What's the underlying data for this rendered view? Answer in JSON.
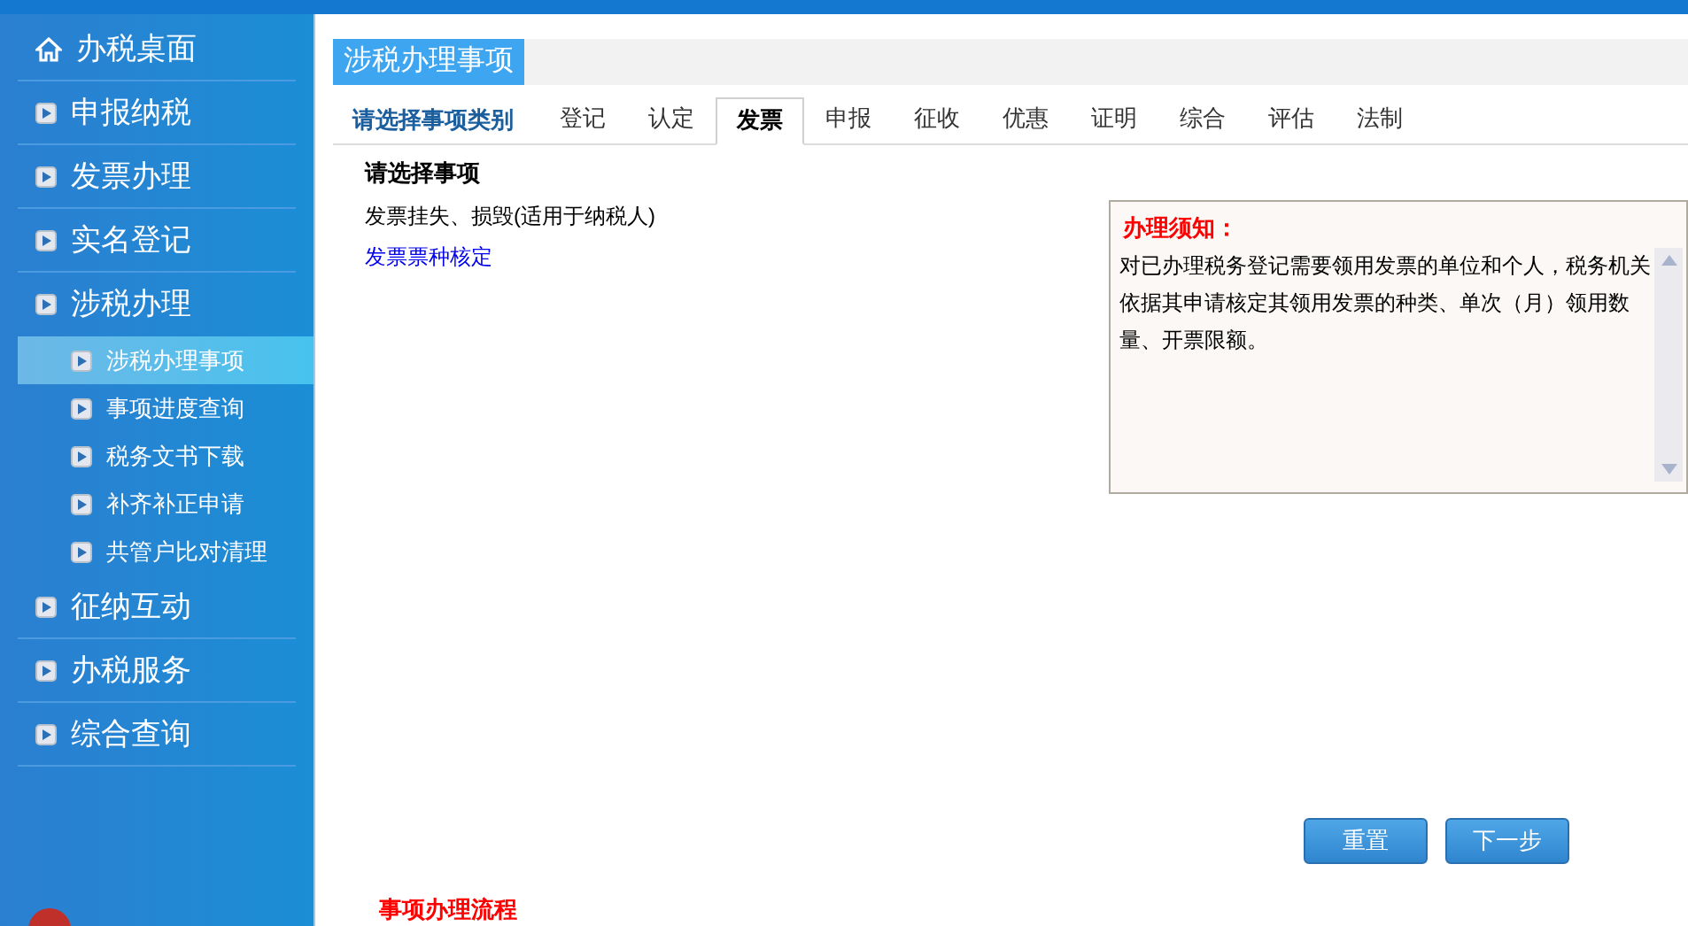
{
  "sidebar": {
    "items": [
      {
        "label": "办税桌面",
        "kind": "home",
        "expanded": false
      },
      {
        "label": "申报纳税",
        "kind": "section",
        "expanded": false
      },
      {
        "label": "发票办理",
        "kind": "section",
        "expanded": false
      },
      {
        "label": "实名登记",
        "kind": "section",
        "expanded": false
      },
      {
        "label": "涉税办理",
        "kind": "section",
        "expanded": true,
        "children": [
          {
            "label": "涉税办理事项",
            "selected": true
          },
          {
            "label": "事项进度查询",
            "selected": false
          },
          {
            "label": "税务文书下载",
            "selected": false
          },
          {
            "label": "补齐补正申请",
            "selected": false
          },
          {
            "label": "共管户比对清理",
            "selected": false
          }
        ]
      },
      {
        "label": "征纳互动",
        "kind": "section",
        "expanded": false
      },
      {
        "label": "办税服务",
        "kind": "section",
        "expanded": false
      },
      {
        "label": "综合查询",
        "kind": "section",
        "expanded": false
      }
    ]
  },
  "page_title": "涉税办理事项",
  "category_label": "请选择事项类别",
  "tabs": [
    {
      "label": "登记",
      "selected": false
    },
    {
      "label": "认定",
      "selected": false
    },
    {
      "label": "发票",
      "selected": true
    },
    {
      "label": "申报",
      "selected": false
    },
    {
      "label": "征收",
      "selected": false
    },
    {
      "label": "优惠",
      "selected": false
    },
    {
      "label": "证明",
      "selected": false
    },
    {
      "label": "综合",
      "selected": false
    },
    {
      "label": "评估",
      "selected": false
    },
    {
      "label": "法制",
      "selected": false
    }
  ],
  "items_heading": "请选择事项",
  "items": [
    {
      "label": "发票挂失、损毁(适用于纳税人)",
      "kind": "text"
    },
    {
      "label": "发票票种核定",
      "kind": "link"
    }
  ],
  "notice": {
    "title": "办理须知：",
    "body": "对已办理税务登记需要领用发票的单位和个人，税务机关依据其申请核定其领用发票的种类、单次（月）领用数量、开票限额。"
  },
  "buttons": [
    "重置",
    "下一步"
  ],
  "flow_heading": "事项办理流程"
}
